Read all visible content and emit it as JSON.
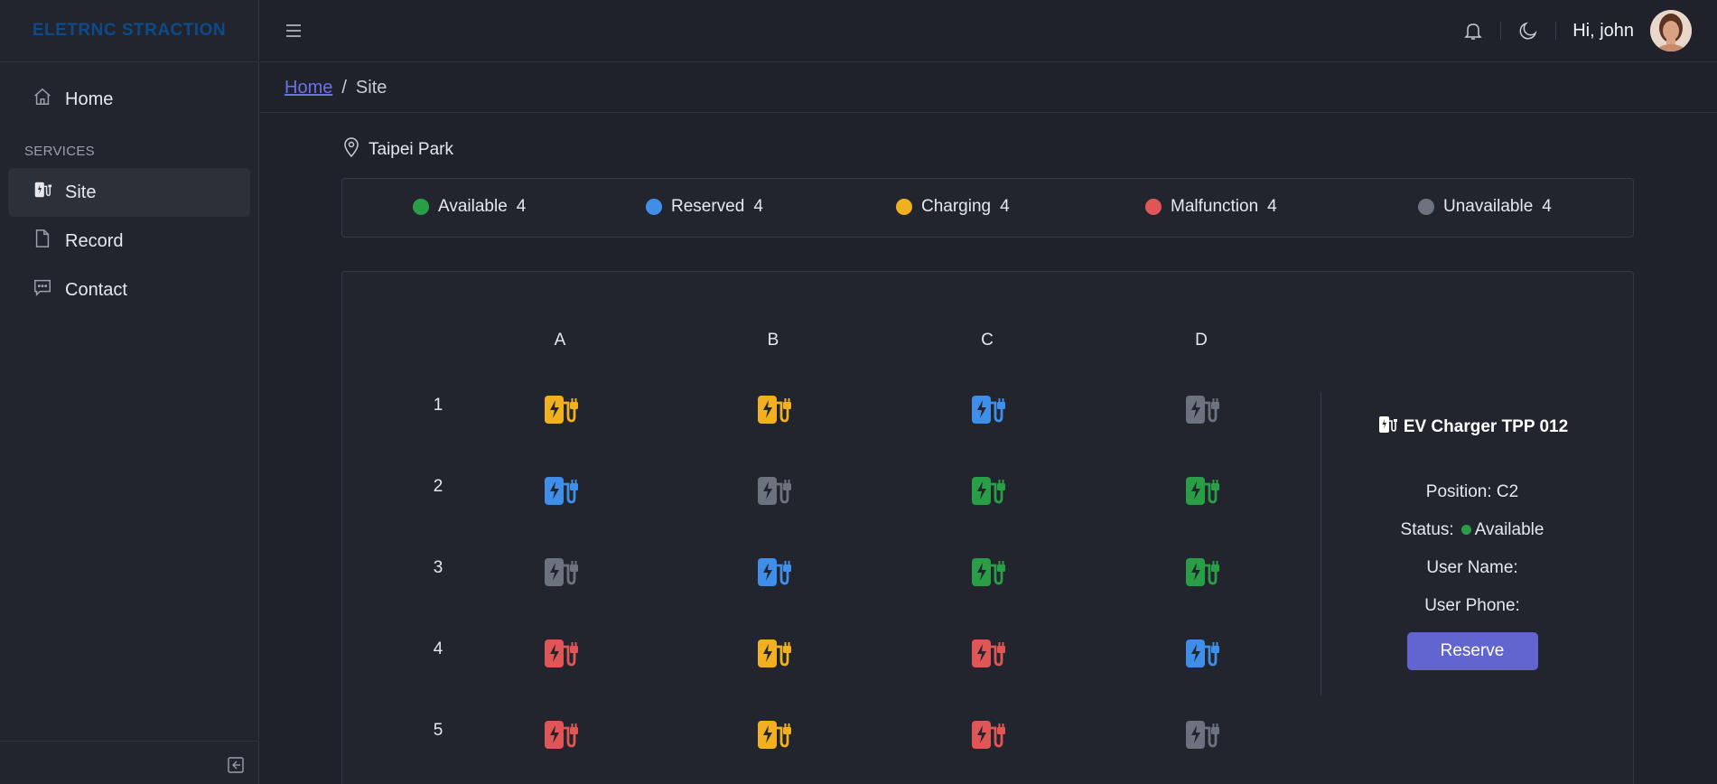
{
  "app": {
    "logo_text": "ELETRNC STRACTION"
  },
  "sidebar": {
    "items": [
      {
        "label": "Home",
        "icon": "home-icon",
        "active": false
      },
      {
        "label": "Site",
        "icon": "ev-charger-icon",
        "active": true
      },
      {
        "label": "Record",
        "icon": "document-icon",
        "active": false
      },
      {
        "label": "Contact",
        "icon": "chat-icon",
        "active": false
      }
    ],
    "section_label": "SERVICES"
  },
  "header": {
    "greeting": "Hi, john"
  },
  "breadcrumb": {
    "home": "Home",
    "separator": "/",
    "current": "Site"
  },
  "site": {
    "name": "Taipei Park"
  },
  "colors": {
    "available": "#2a9d47",
    "reserved": "#3f8fe8",
    "charging": "#f0b020",
    "malfunction": "#e05656",
    "unavailable": "#6c727e",
    "accent": "#6265cf"
  },
  "legend": [
    {
      "status": "available",
      "label": "Available",
      "count": "4"
    },
    {
      "status": "reserved",
      "label": "Reserved",
      "count": "4"
    },
    {
      "status": "charging",
      "label": "Charging",
      "count": "4"
    },
    {
      "status": "malfunction",
      "label": "Malfunction",
      "count": "4"
    },
    {
      "status": "unavailable",
      "label": "Unavailable",
      "count": "4"
    }
  ],
  "grid": {
    "columns": [
      "A",
      "B",
      "C",
      "D"
    ],
    "rows": [
      {
        "label": "1",
        "cells": [
          "charging",
          "charging",
          "reserved",
          "unavailable"
        ]
      },
      {
        "label": "2",
        "cells": [
          "reserved",
          "unavailable",
          "available",
          "available"
        ]
      },
      {
        "label": "3",
        "cells": [
          "unavailable",
          "reserved",
          "available",
          "available"
        ]
      },
      {
        "label": "4",
        "cells": [
          "malfunction",
          "charging",
          "malfunction",
          "reserved"
        ]
      },
      {
        "label": "5",
        "cells": [
          "malfunction",
          "charging",
          "malfunction",
          "unavailable"
        ]
      }
    ]
  },
  "detail": {
    "title": "EV Charger TPP 012",
    "position_label": "Position:",
    "position_value": "C2",
    "status_label": "Status:",
    "status_value": "Available",
    "user_name_label": "User Name:",
    "user_phone_label": "User Phone:",
    "reserve_label": "Reserve"
  }
}
